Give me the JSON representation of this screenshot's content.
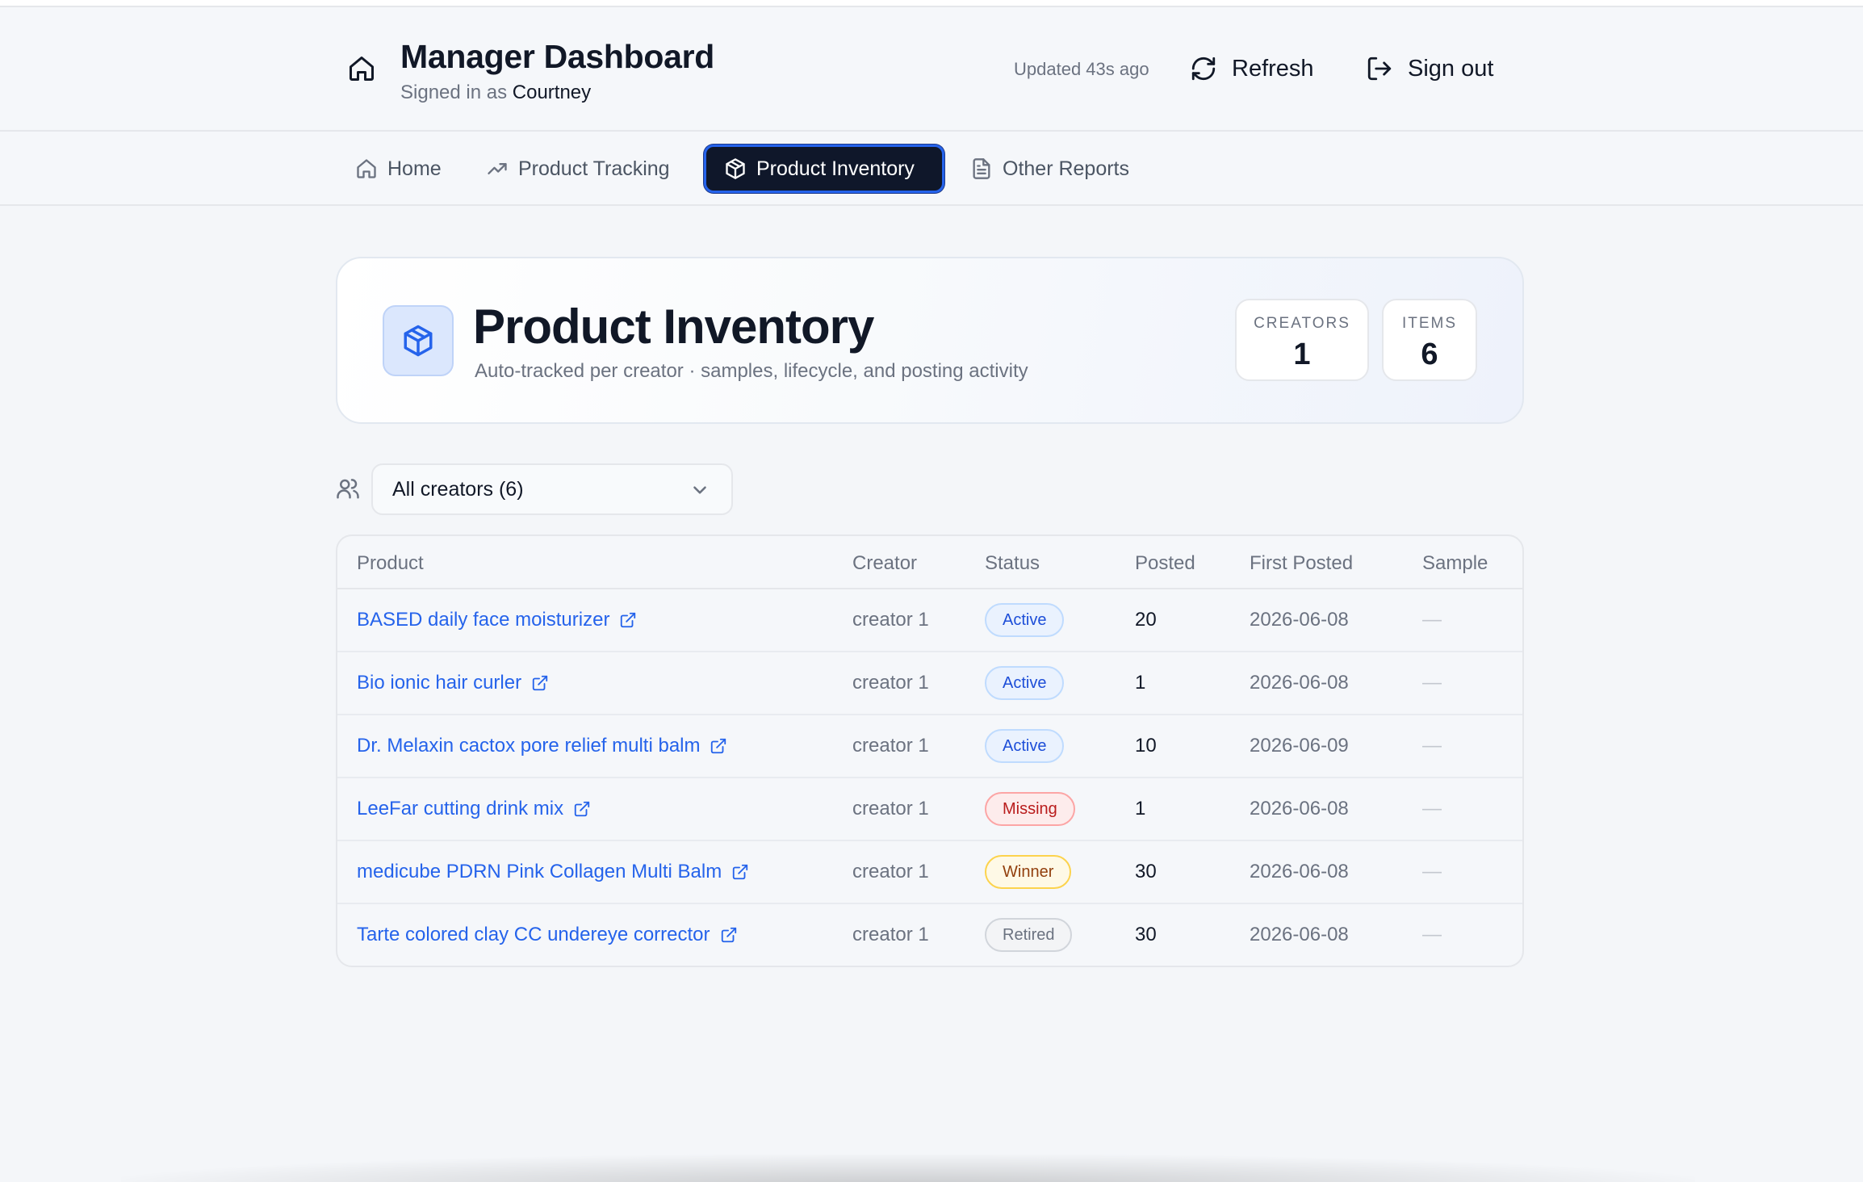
{
  "header": {
    "title": "Manager Dashboard",
    "signed_in_prefix": "Signed in as",
    "user": "Courtney",
    "updated": "Updated 43s ago",
    "refresh_label": "Refresh",
    "signout_label": "Sign out"
  },
  "nav": {
    "tabs": [
      {
        "label": "Home",
        "icon": "home-icon"
      },
      {
        "label": "Product Tracking",
        "icon": "trending-up-icon"
      },
      {
        "label": "Product Inventory",
        "icon": "package-icon",
        "active": true
      },
      {
        "label": "Other Reports",
        "icon": "file-text-icon"
      }
    ]
  },
  "hero": {
    "title": "Product Inventory",
    "subtitle": "Auto-tracked per creator · samples, lifecycle, and posting activity",
    "stats": [
      {
        "label": "CREATORS",
        "value": "1"
      },
      {
        "label": "ITEMS",
        "value": "6"
      }
    ]
  },
  "filter": {
    "selected": "All creators (6)"
  },
  "table": {
    "columns": [
      "Product",
      "Creator",
      "Status",
      "Posted",
      "First Posted",
      "Sample"
    ],
    "rows": [
      {
        "product": "BASED daily face moisturizer",
        "creator": "creator 1",
        "status": "Active",
        "posted": "20",
        "first_posted": "2026-06-08",
        "sample": "—"
      },
      {
        "product": "Bio ionic hair curler",
        "creator": "creator 1",
        "status": "Active",
        "posted": "1",
        "first_posted": "2026-06-08",
        "sample": "—"
      },
      {
        "product": "Dr. Melaxin cactox pore relief multi balm",
        "creator": "creator 1",
        "status": "Active",
        "posted": "10",
        "first_posted": "2026-06-09",
        "sample": "—"
      },
      {
        "product": "LeeFar cutting drink mix",
        "creator": "creator 1",
        "status": "Missing",
        "posted": "1",
        "first_posted": "2026-06-08",
        "sample": "—"
      },
      {
        "product": "medicube PDRN Pink Collagen Multi Balm",
        "creator": "creator 1",
        "status": "Winner",
        "posted": "30",
        "first_posted": "2026-06-08",
        "sample": "—"
      },
      {
        "product": "Tarte colored clay CC undereye corrector",
        "creator": "creator 1",
        "status": "Retired",
        "posted": "30",
        "first_posted": "2026-06-08",
        "sample": "—"
      }
    ]
  },
  "colors": {
    "accent": "#2563eb",
    "nav_active_bg": "#0f172a",
    "status_active": "#1d4ed8",
    "status_missing": "#b91c1c",
    "status_winner": "#92400e",
    "status_retired": "#6b7280"
  }
}
